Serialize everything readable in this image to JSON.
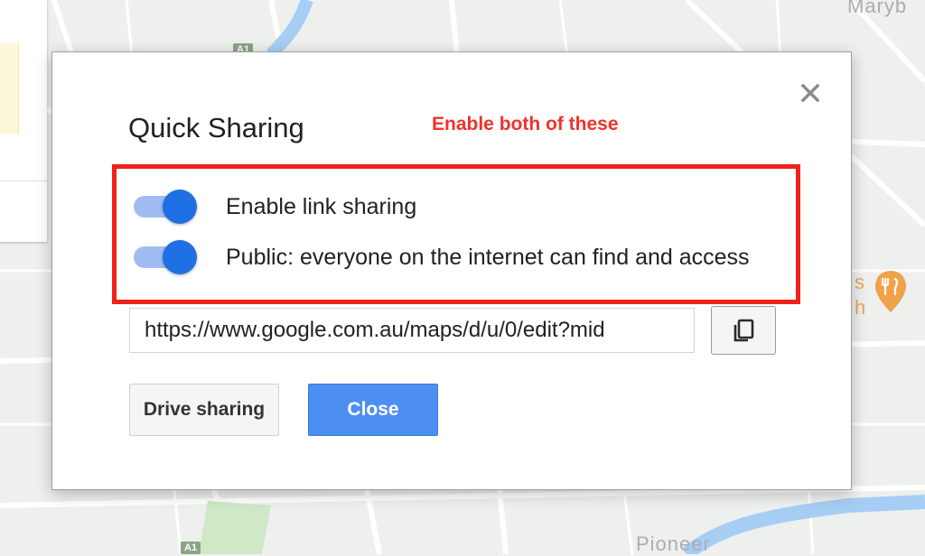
{
  "map": {
    "labels": {
      "top_right": "Maryb",
      "bottom": "Pioneer",
      "poi_fragment_a": "s",
      "poi_fragment_b": "h"
    },
    "road_badges": {
      "top": "A1",
      "bottom": "A1"
    }
  },
  "dialog": {
    "title": "Quick Sharing",
    "annotation": "Enable both of these",
    "toggles": [
      {
        "label": "Enable link sharing",
        "on": true
      },
      {
        "label": "Public: everyone on the internet can find and access",
        "on": true
      }
    ],
    "url_value": "https://www.google.com.au/maps/d/u/0/edit?mid",
    "buttons": {
      "drive_sharing": "Drive sharing",
      "close": "Close"
    },
    "icons": {
      "close": "close-icon",
      "copy": "copy-icon"
    },
    "colors": {
      "annotation": "#f0322a",
      "highlight_border": "#f2211b",
      "toggle_thumb": "#1f6fe5",
      "toggle_track": "#9fbdf2",
      "primary_button": "#4d8ff0"
    }
  }
}
